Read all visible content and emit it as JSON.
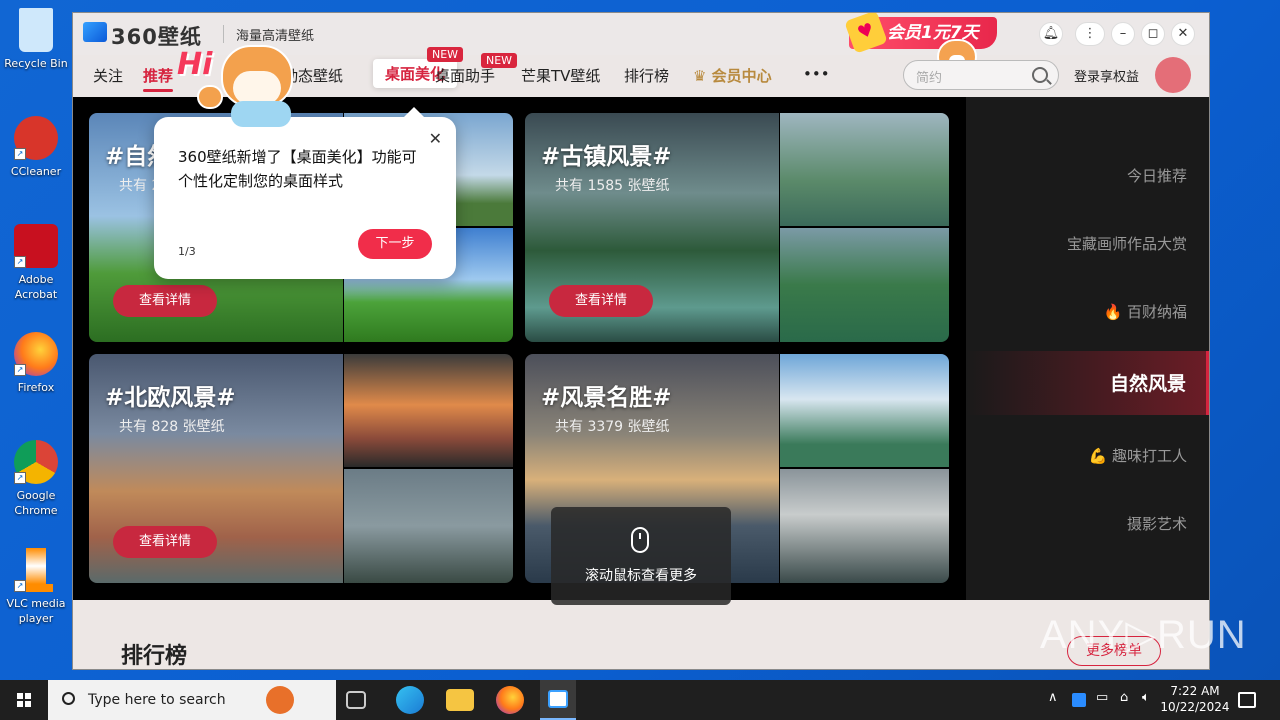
{
  "desktop": {
    "icons": [
      {
        "label": "Recycle Bin",
        "color": "#8ecbf0"
      },
      {
        "label": "CCleaner",
        "color": "#d8352a"
      },
      {
        "label": "Adobe Acrobat",
        "color": "#c8101f"
      },
      {
        "label": "Firefox",
        "color": "#ff7a1a"
      },
      {
        "label": "Google Chrome",
        "color": "#2b9a3d"
      },
      {
        "label": "VLC media player",
        "color": "#ff8c00"
      }
    ]
  },
  "app": {
    "logo": "360壁纸",
    "slogan": "海量高清壁纸",
    "promo": "会员1元7天",
    "nav": [
      {
        "label": "关注"
      },
      {
        "label": "推荐"
      },
      {
        "label": "动态壁纸"
      },
      {
        "label": "桌面美化",
        "badge": "NEW"
      },
      {
        "label": "桌面助手",
        "badge": "NEW"
      },
      {
        "label": "芒果TV壁纸"
      },
      {
        "label": "排行榜"
      },
      {
        "label": "会员中心"
      },
      {
        "label": "•••"
      }
    ],
    "search_placeholder": "简约",
    "login": "登录享权益",
    "cards": [
      {
        "title": "#自然风景#",
        "count": "共有 2167 张壁纸",
        "button": "查看详情"
      },
      {
        "title": "#古镇风景#",
        "count": "共有 1585 张壁纸",
        "button": "查看详情"
      },
      {
        "title": "#北欧风景#",
        "count": "共有 828 张壁纸",
        "button": "查看详情"
      },
      {
        "title": "#风景名胜#",
        "count": "共有 3379 张壁纸",
        "button": "查看详情"
      }
    ],
    "side_menu": [
      {
        "label": "今日推荐"
      },
      {
        "label": "宝藏画师作品大赏"
      },
      {
        "label": "🔥 百财纳福"
      },
      {
        "label": "自然风景"
      },
      {
        "label": "💪 趣味打工人"
      },
      {
        "label": "摄影艺术"
      }
    ],
    "ranking_title": "排行榜",
    "ranking_more": "更多榜单",
    "tooltip": {
      "text": "360壁纸新增了【桌面美化】功能可个性化定制您的桌面样式",
      "step": "1/3",
      "next": "下一步"
    },
    "mascot_text": "Hi",
    "scroll_hint": "滚动鼠标查看更多"
  },
  "watermark": "ANY▷RUN",
  "taskbar": {
    "search_placeholder": "Type here to search",
    "time": "7:22 AM",
    "date": "10/22/2024"
  }
}
